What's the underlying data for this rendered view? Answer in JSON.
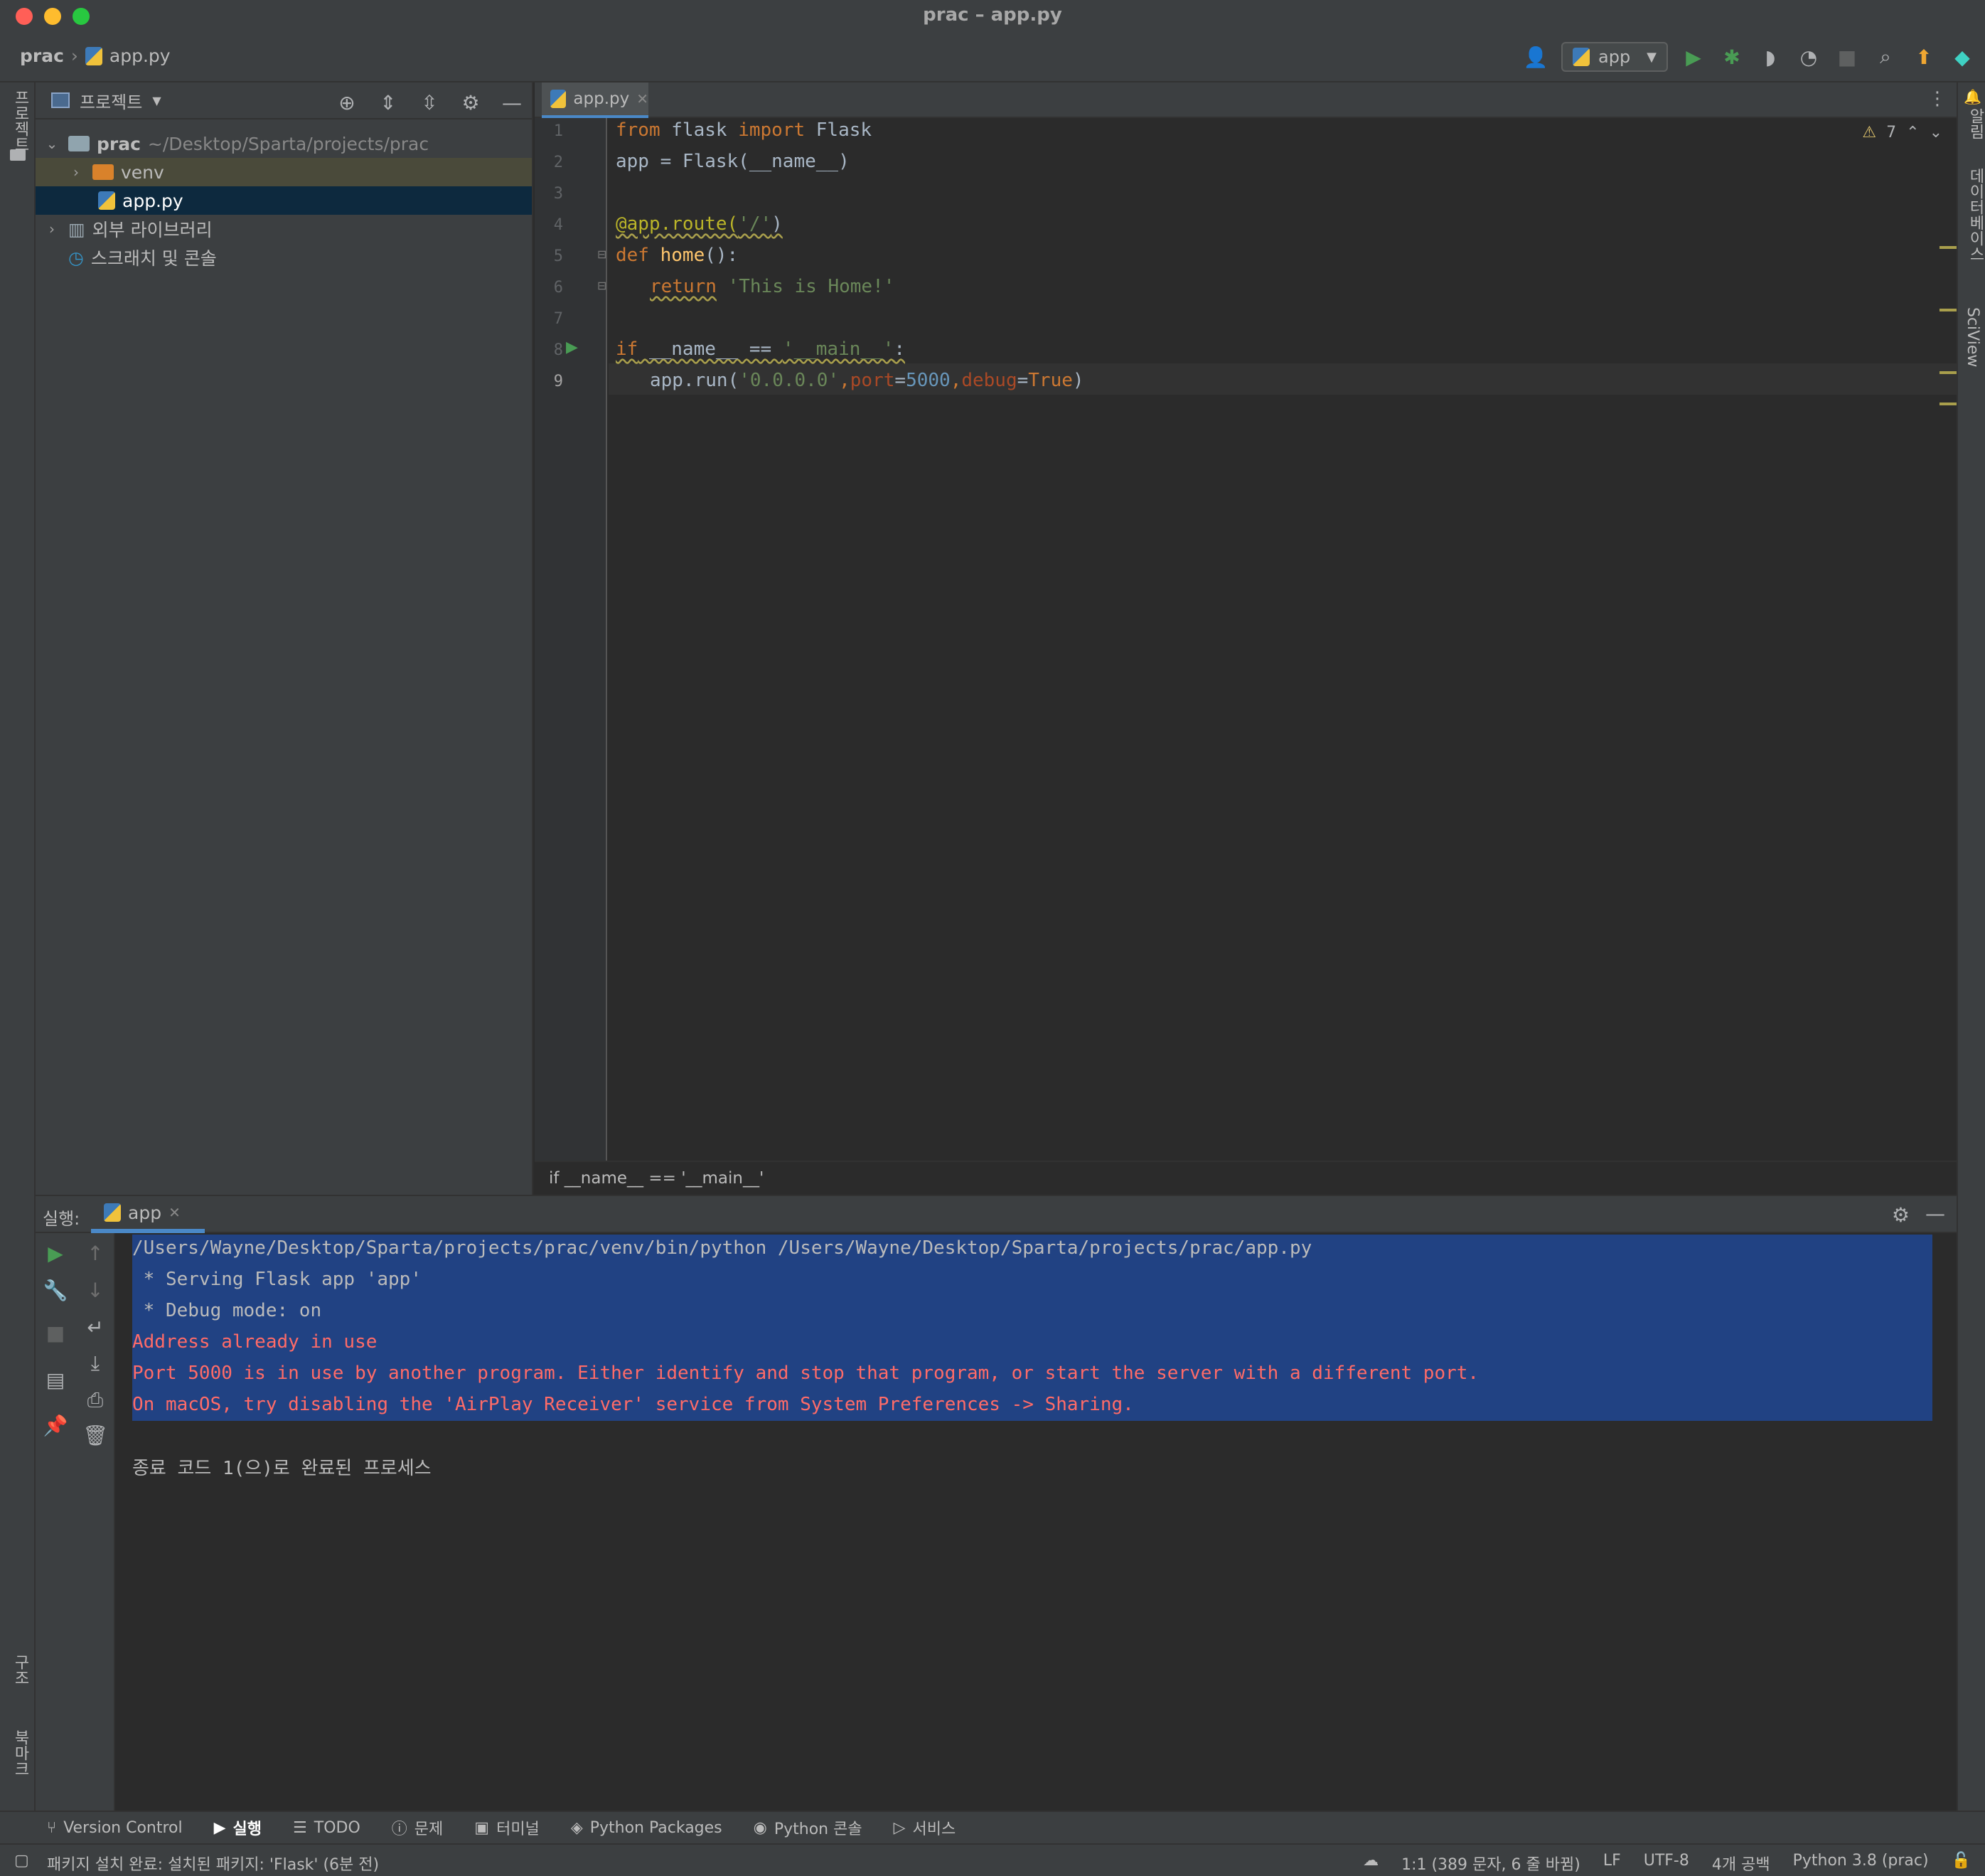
{
  "window": {
    "title": "prac – app.py"
  },
  "colors": {
    "close": "#ff5f57",
    "minimize": "#febc2e",
    "zoom": "#28c840",
    "selection": "#214283",
    "error": "#ff6b68"
  },
  "breadcrumb": {
    "project": "prac",
    "file": "app.py"
  },
  "toolbar": {
    "run_config": "app",
    "icons": [
      "user-icon",
      "run-icon",
      "debug-icon",
      "coverage-icon",
      "profile-icon",
      "stop-icon",
      "search-icon",
      "update-icon",
      "jetbrains-icon"
    ]
  },
  "left_strip": {
    "project": "프로젝트",
    "structure": "구조",
    "bookmarks": "북마크"
  },
  "right_strip": {
    "notifications": "알림",
    "database": "데이터베이스",
    "sciview": "SciView"
  },
  "project_panel": {
    "title": "프로젝트",
    "root_name": "prac",
    "root_path": "~/Desktop/Sparta/projects/prac",
    "items": [
      {
        "label": "venv"
      },
      {
        "label": "app.py"
      },
      {
        "label": "외부 라이브러리"
      },
      {
        "label": "스크래치 및 콘솔"
      }
    ]
  },
  "editor": {
    "tab": "app.py",
    "warnings": "7",
    "line_numbers": [
      "1",
      "2",
      "3",
      "4",
      "5",
      "6",
      "7",
      "8",
      "9"
    ],
    "lines": {
      "l1_kw1": "from",
      "l1_mod": " flask ",
      "l1_kw2": "import",
      "l1_cls": " Flask",
      "l2": "app = Flask(__name__)",
      "l4_dec": "@app.route(",
      "l4_str": "'/'",
      "l4_end": ")",
      "l5_kw": "def",
      "l5_fn": " home",
      "l5_end": "():",
      "l6_kw": "return",
      "l6_str": " 'This is Home!'",
      "l8_kw": "if",
      "l8_mid": " __name__ == ",
      "l8_str": "'__main__'",
      "l8_end": ":",
      "l9_a": "app.run(",
      "l9_s": "'0.0.0.0'",
      "l9_c1": ",",
      "l9_p1": "port",
      "l9_eq1": "=",
      "l9_n": "5000",
      "l9_c2": ",",
      "l9_p2": "debug",
      "l9_eq2": "=",
      "l9_t": "True",
      "l9_end": ")"
    },
    "crumb": "if __name__ == '__main__'"
  },
  "run_panel": {
    "label": "실행:",
    "tab": "app",
    "lines": [
      "/Users/Wayne/Desktop/Sparta/projects/prac/venv/bin/python /Users/Wayne/Desktop/Sparta/projects/prac/app.py",
      " * Serving Flask app 'app'",
      " * Debug mode: on",
      "Address already in use",
      "Port 5000 is in use by another program. Either identify and stop that program, or start the server with a different port.",
      "On macOS, try disabling the 'AirPlay Receiver' service from System Preferences -> Sharing.",
      "종료 코드 1(으)로 완료된 프로세스"
    ]
  },
  "tool_windows": [
    "Version Control",
    "실행",
    "TODO",
    "문제",
    "터미널",
    "Python Packages",
    "Python 콘솔",
    "서비스"
  ],
  "status": {
    "message": "패키지 설치 완료: 설치된 패키지: 'Flask' (6분 전)",
    "position": "1:1 (389 문자, 6 줄 바뀜)",
    "line_sep": "LF",
    "encoding": "UTF-8",
    "indent": "4개 공백",
    "interpreter": "Python 3.8 (prac)"
  }
}
